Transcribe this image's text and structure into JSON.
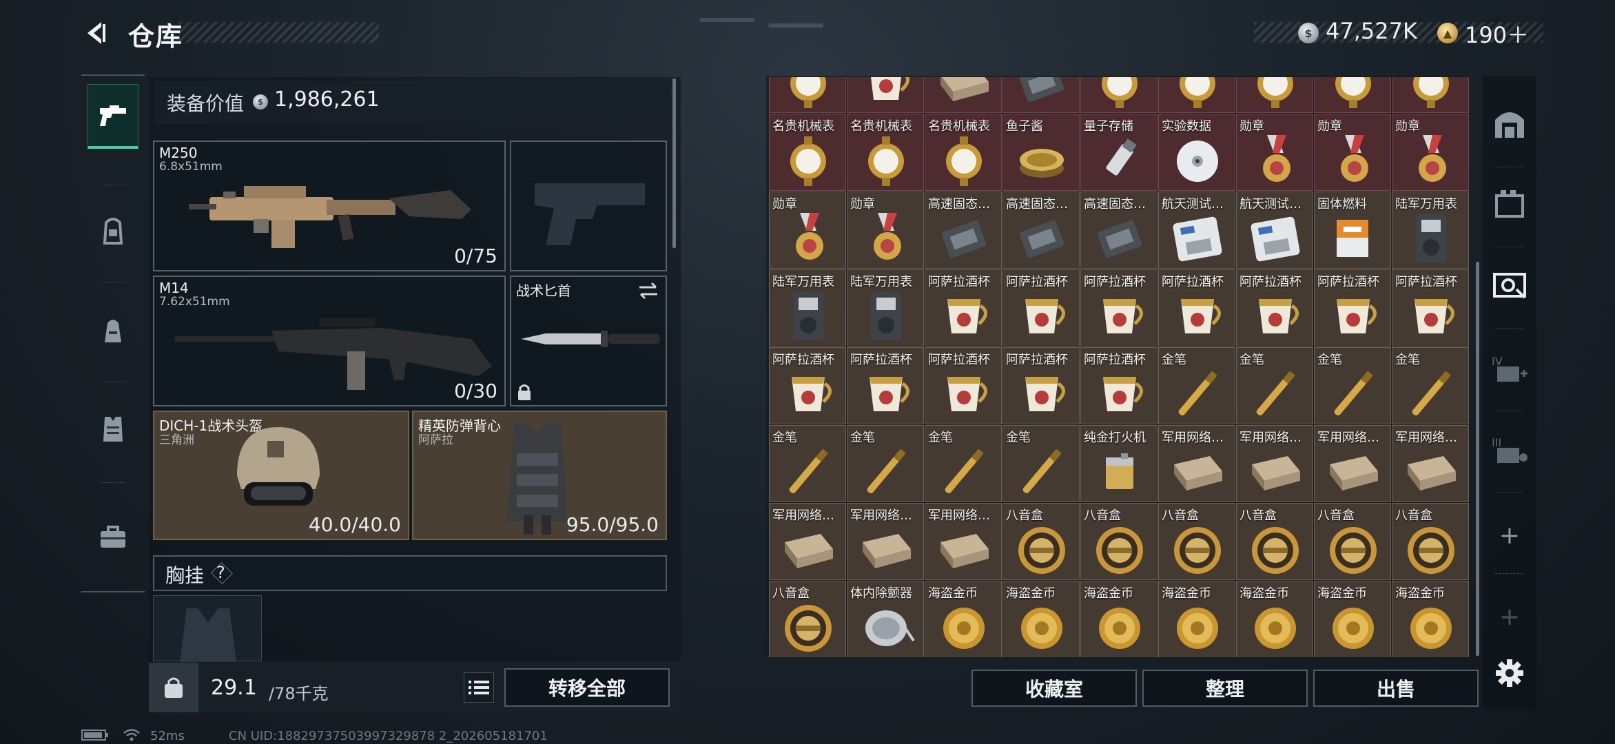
{
  "header": {
    "title": "仓库",
    "silver_amount": "47,527K",
    "gold_amount": "190＋",
    "icons": [
      "back-arrow-icon",
      "silver-coin-icon",
      "gold-coin-icon"
    ]
  },
  "left_nav": {
    "items": [
      {
        "icon": "pistol-icon",
        "active": true
      },
      {
        "icon": "backpack-tag-icon",
        "active": false
      },
      {
        "icon": "backpack-icon",
        "active": false
      },
      {
        "icon": "vest-icon",
        "active": false
      },
      {
        "icon": "toolbox-icon",
        "active": false
      }
    ]
  },
  "equipment": {
    "value_label": "装备价值",
    "value_amount": "1,986,261",
    "primary_weapon": {
      "name": "M250",
      "caliber": "6.8x51mm",
      "ammo": "0/75"
    },
    "secondary_weapon": {
      "name": "M14",
      "caliber": "7.62x51mm",
      "ammo": "0/30"
    },
    "melee": {
      "name": "战术匕首"
    },
    "helmet": {
      "name": "DICH-1战术头盔",
      "sub": "三角洲",
      "durability": "40.0/40.0"
    },
    "armor": {
      "name": "精英防弹背心",
      "sub": "阿萨拉",
      "durability": "95.0/95.0"
    },
    "chest_rig_label": "胸挂",
    "chest_rig_help": "?",
    "weight_value": "29.1",
    "weight_max": "/78千克",
    "transfer_all": "转移全部"
  },
  "storage": {
    "rows": [
      [
        "",
        "",
        "",
        "",
        "",
        "",
        "",
        ""
      ],
      [
        "名贵机械表",
        "名贵机械表",
        "名贵机械表",
        "鱼子酱",
        "量子存储",
        "实验数据",
        "勋章",
        "勋章",
        "勋章"
      ],
      [
        "勋章",
        "勋章",
        "高速固态…",
        "高速固态…",
        "高速固态…",
        "航天测试…",
        "航天测试…",
        "固体燃料",
        "陆军万用表"
      ],
      [
        "陆军万用表",
        "陆军万用表",
        "阿萨拉酒杯",
        "阿萨拉酒杯",
        "阿萨拉酒杯",
        "阿萨拉酒杯",
        "阿萨拉酒杯",
        "阿萨拉酒杯",
        "阿萨拉酒杯"
      ],
      [
        "阿萨拉酒杯",
        "阿萨拉酒杯",
        "阿萨拉酒杯",
        "阿萨拉酒杯",
        "阿萨拉酒杯",
        "金笔",
        "金笔",
        "金笔",
        "金笔"
      ],
      [
        "金笔",
        "金笔",
        "金笔",
        "金笔",
        "纯金打火机",
        "军用网络…",
        "军用网络…",
        "军用网络…",
        "军用网络…"
      ],
      [
        "军用网络…",
        "军用网络…",
        "军用网络…",
        "八音盒",
        "八音盒",
        "八音盒",
        "八音盒",
        "八音盒",
        "八音盒"
      ],
      [
        "八音盒",
        "体内除颤器",
        "海盗金币",
        "海盗金币",
        "海盗金币",
        "海盗金币",
        "海盗金币",
        "海盗金币",
        "海盗金币"
      ]
    ],
    "buttons": {
      "collection": "收藏室",
      "sort": "整理",
      "sell": "出售"
    }
  },
  "right_nav": {
    "items": [
      "safe-icon",
      "storage-box-icon",
      "vault-icon",
      "expand-iv-icon",
      "expand-iii-icon",
      "add-icon",
      "add-disabled-icon",
      "gear-icon"
    ],
    "plus": "+"
  },
  "status_bar": {
    "ping": "52ms",
    "uid": "CN UID:18829737503997329878 2_202605181701"
  },
  "colors": {
    "accent_green": "#49c9a4",
    "rare_red_cell": "#4d2b2e",
    "cell_brown": "#453a31"
  }
}
